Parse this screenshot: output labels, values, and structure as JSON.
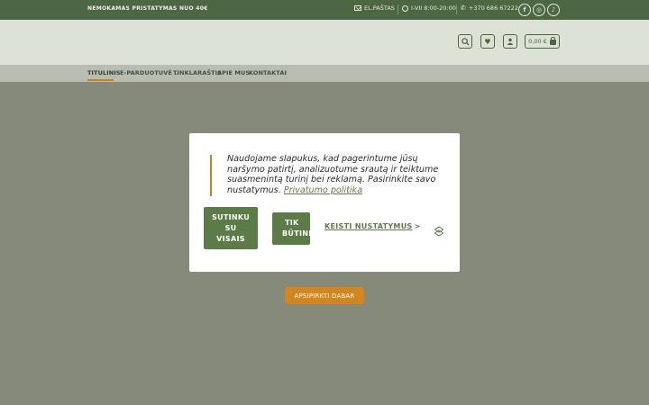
{
  "topbar": {
    "promo": "NEMOKAMAS PRISTATYMAS NUO 40€",
    "email_label": "EL.PAŠTAS",
    "hours": "I-VII 8:00-20:00",
    "phone": "+370 686 67222",
    "socials": [
      {
        "name": "facebook",
        "glyph": "f"
      },
      {
        "name": "instagram",
        "glyph": "◎"
      },
      {
        "name": "tiktok",
        "glyph": "♪"
      }
    ]
  },
  "header": {
    "icons": [
      "search-icon",
      "heart-icon",
      "user-icon"
    ],
    "cart_total": "0,00 €"
  },
  "nav": {
    "items": [
      {
        "label": "TITULINIS",
        "active": true
      },
      {
        "label": "E-PARDUOTUVĖ",
        "has_dropdown": true
      },
      {
        "label": "TINKLARAŠTIS"
      },
      {
        "label": "APIE MUS"
      },
      {
        "label": "KONTAKTAI"
      }
    ]
  },
  "hero": {
    "shop_button": "APSIPIRKTI DABAR"
  },
  "cookie_modal": {
    "text": "Naudojame slapukus, kad pagerintume jūsų naršymo patirtį, analizuotume srautą ir teiktume suasmenintą turinį bei reklamą. Pasirinkite savo nustatymus.",
    "policy_link": "Privatumo politika",
    "accept_all": [
      "SUTINKU",
      "SU",
      "VISAIS"
    ],
    "required_only": [
      "TIK",
      "BŪTINI"
    ],
    "settings_label": "KEISTI NUSTATYMUS",
    "settings_arrow": ">"
  },
  "colors": {
    "brand_green": "#5b7b47",
    "topbar_green": "#4e6743",
    "accent_orange": "#d4861c",
    "overlay": "#868a7b"
  }
}
